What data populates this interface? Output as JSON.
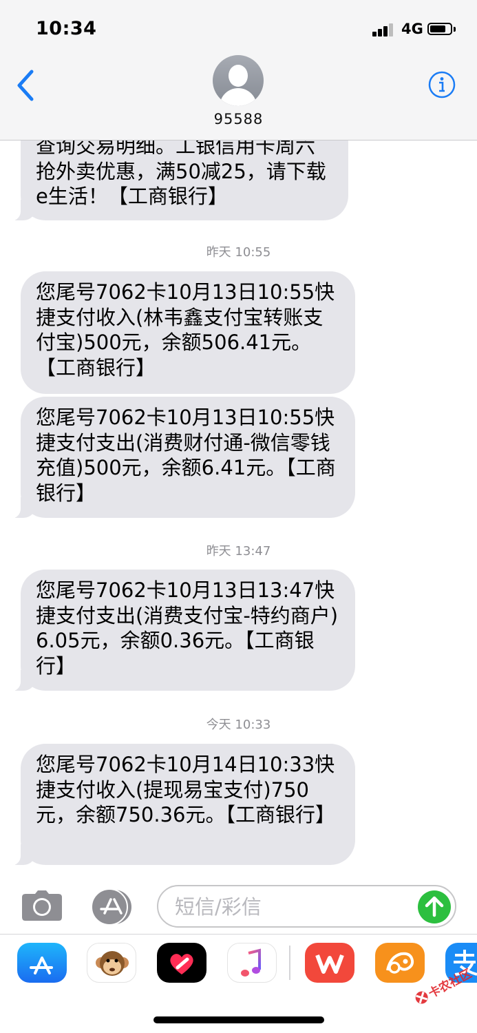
{
  "status_bar": {
    "time": "10:34",
    "network": "4G"
  },
  "header": {
    "contact_name": "95588"
  },
  "messages": [
    {
      "type": "bubble",
      "text": "查询交易明细。工银信用卡周六抢外卖优惠，满50减25，请下载e生活！【工商银行】"
    },
    {
      "type": "timestamp",
      "text": "昨天 10:55"
    },
    {
      "type": "bubble",
      "text": "您尾号7062卡10月13日10:55快捷支付收入(林韦鑫支付宝转账支付宝)500元，余额506.41元。【工商银行】"
    },
    {
      "type": "bubble",
      "text": "您尾号7062卡10月13日10:55快捷支付支出(消费财付通-微信零钱充值)500元，余额6.41元。【工商银行】"
    },
    {
      "type": "timestamp",
      "text": "昨天 13:47"
    },
    {
      "type": "bubble",
      "text": "您尾号7062卡10月13日13:47快捷支付支出(消费支付宝-特约商户)6.05元，余额0.36元。【工商银行】"
    },
    {
      "type": "timestamp",
      "text": "今天 10:33"
    },
    {
      "type": "bubble",
      "text": "您尾号7062卡10月14日10:33快捷支付收入(提现易宝支付)750元，余额750.36元。【工商银行】"
    }
  ],
  "compose": {
    "placeholder": "短信/彩信"
  },
  "app_drawer": [
    {
      "name": "app-store",
      "color": "#1a8cf6"
    },
    {
      "name": "animoji",
      "color": "#ffffff"
    },
    {
      "name": "digital-touch",
      "color": "#000000"
    },
    {
      "name": "music",
      "color": "#ffffff"
    },
    {
      "name": "wps-office",
      "color": "#f2483b"
    },
    {
      "name": "uc-browser",
      "color": "#f7911c"
    },
    {
      "name": "alipay",
      "color": "#1a8cf6"
    }
  ],
  "watermark": {
    "text": "卡农社区"
  }
}
